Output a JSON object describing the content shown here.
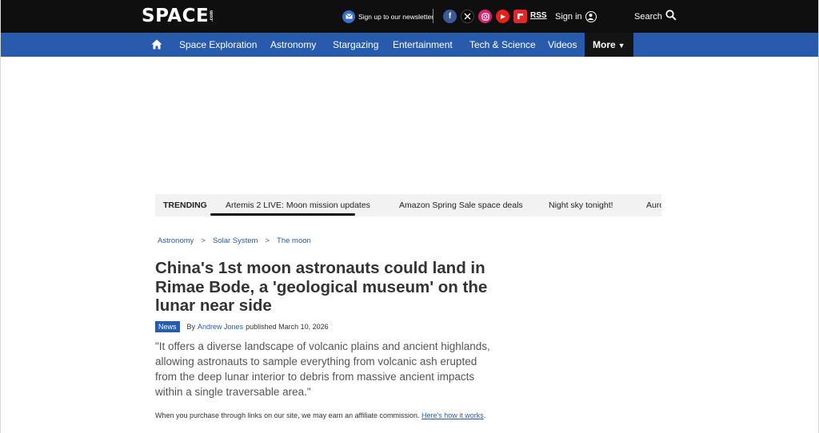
{
  "header": {
    "logo": "SPACE",
    "logo_sub": ".com",
    "newsletter": "Sign up to our newsletter",
    "rss": "RSS",
    "signin": "Sign in",
    "search": "Search"
  },
  "colors": {
    "topbar": "#0f0f0f",
    "nav": "#285bab",
    "facebook": "#3b5998",
    "x": "#000000",
    "instagram": "#d6246e",
    "youtube": "#e62117",
    "flipboard": "#e12828"
  },
  "nav": {
    "home_icon": "home-icon",
    "items": [
      "Space Exploration",
      "Astronomy",
      "Stargazing",
      "Entertainment",
      "Tech & Science",
      "Videos"
    ],
    "more": "More"
  },
  "trending": {
    "label": "TRENDING",
    "items": [
      "Artemis 2 LIVE: Moon mission updates",
      "Amazon Spring Sale space deals",
      "Night sky tonight!",
      "Auro"
    ]
  },
  "breadcrumb": [
    "Astronomy",
    "Solar System",
    "The moon"
  ],
  "article": {
    "headline": "China's 1st moon astronauts could land in Rimae Bode, a 'geological museum' on the lunar near side",
    "badge": "News",
    "by": "By",
    "author": "Andrew Jones",
    "published": "published March 10, 2026",
    "quote": "\"It offers a diverse landscape of volcanic plains and ancient highlands, allowing astronauts to sample everything from volcanic ash erupted from the deep lunar interior to debris from massive ancient impacts within a single traversable area.\"",
    "affiliate_text": "When you purchase through links on our site, we may earn an affiliate commission.",
    "affiliate_link": "Here's how it works",
    "affiliate_end": "."
  }
}
